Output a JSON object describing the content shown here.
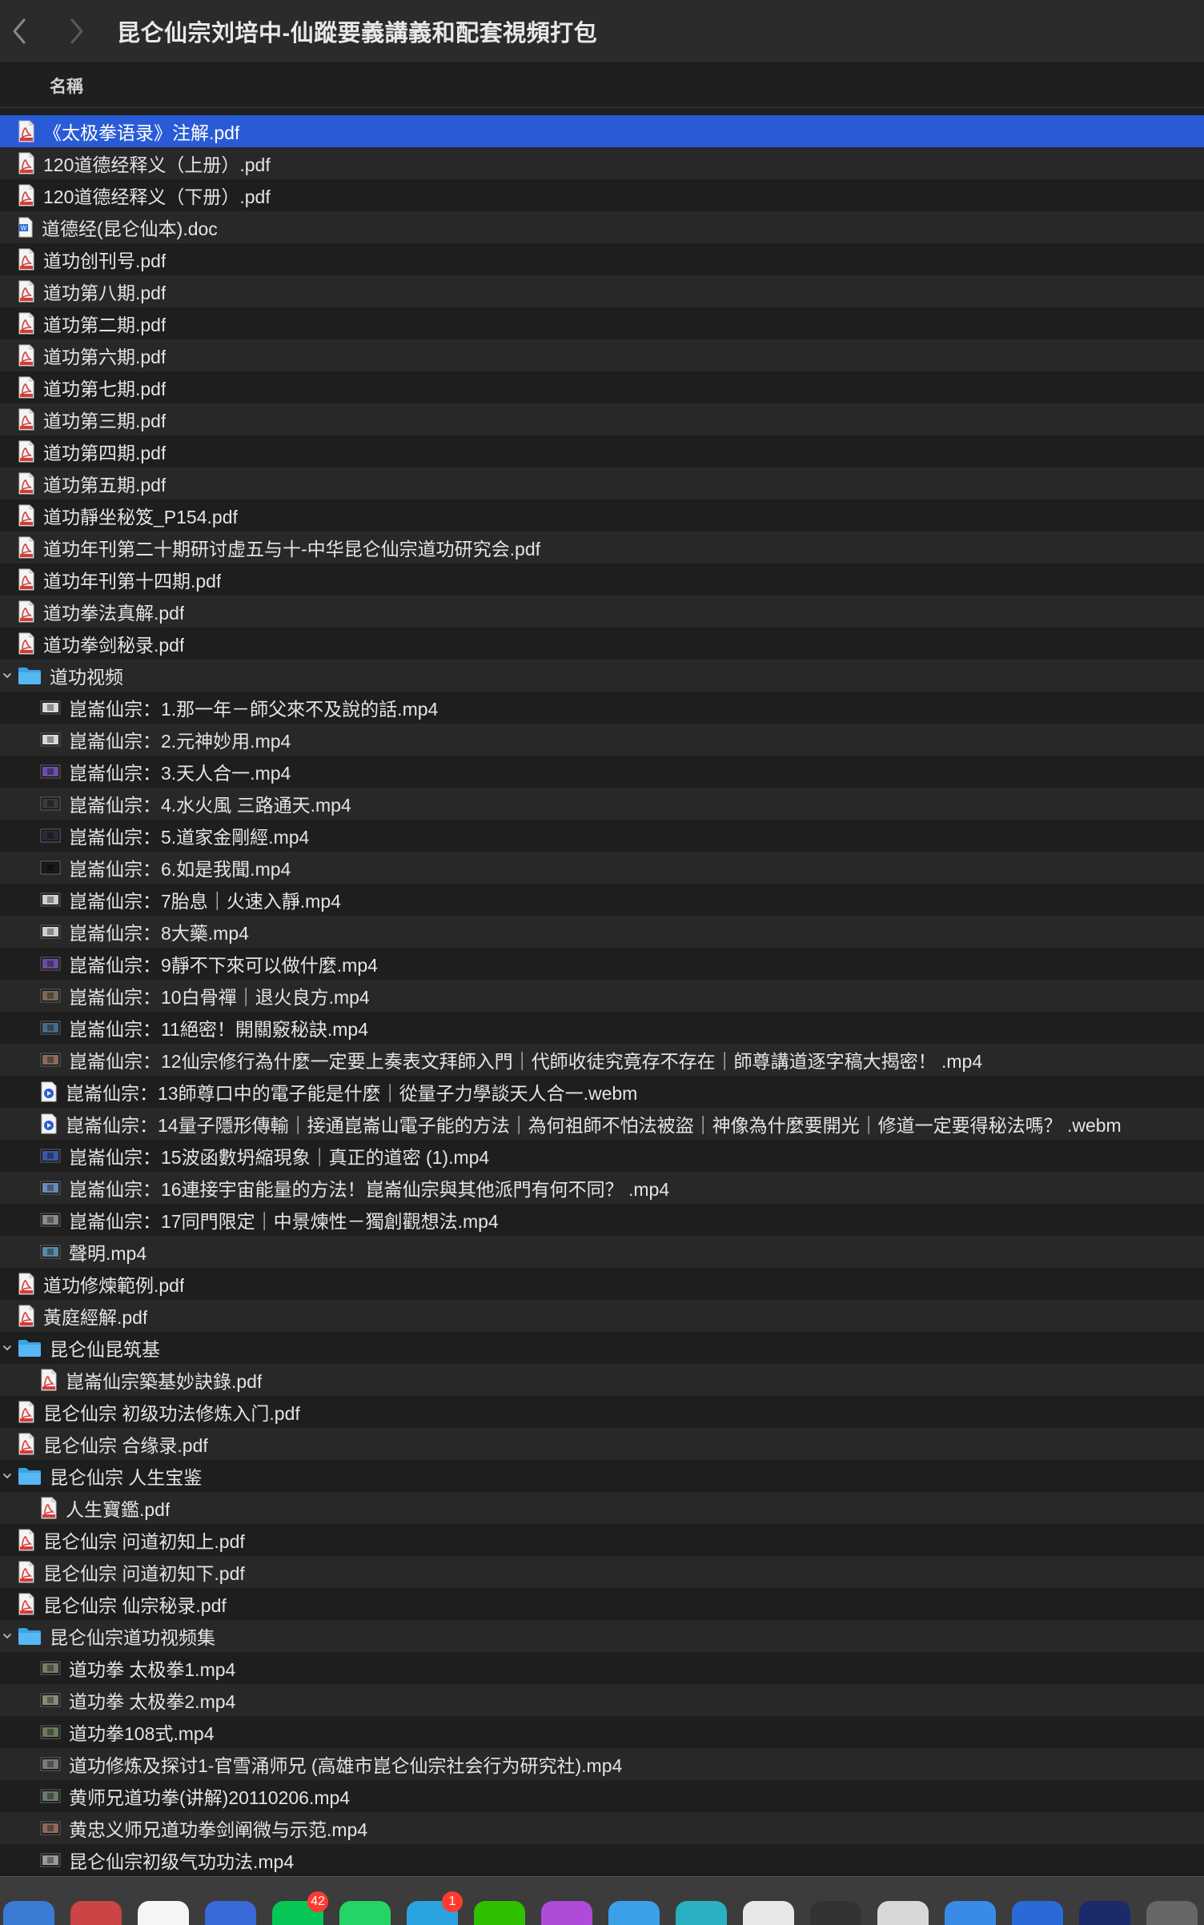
{
  "window": {
    "title": "昆仑仙宗刘培中-仙蹤要義講義和配套視頻打包",
    "back_label": "‹",
    "forward_label": "›"
  },
  "columns": {
    "name_header": "名稱"
  },
  "files": [
    {
      "name": "《太极拳语录》注解.pdf",
      "kind": "pdf",
      "level": 0,
      "selected": true
    },
    {
      "name": "120道德经释义（上册）.pdf",
      "kind": "pdf",
      "level": 0
    },
    {
      "name": "120道德经释义（下册）.pdf",
      "kind": "pdf",
      "level": 0
    },
    {
      "name": "道德经(昆仑仙本).doc",
      "kind": "doc",
      "level": 0
    },
    {
      "name": "道功创刊号.pdf",
      "kind": "pdf",
      "level": 0
    },
    {
      "name": "道功第八期.pdf",
      "kind": "pdf",
      "level": 0
    },
    {
      "name": "道功第二期.pdf",
      "kind": "pdf",
      "level": 0
    },
    {
      "name": "道功第六期.pdf",
      "kind": "pdf",
      "level": 0
    },
    {
      "name": "道功第七期.pdf",
      "kind": "pdf",
      "level": 0
    },
    {
      "name": "道功第三期.pdf",
      "kind": "pdf",
      "level": 0
    },
    {
      "name": "道功第四期.pdf",
      "kind": "pdf",
      "level": 0
    },
    {
      "name": "道功第五期.pdf",
      "kind": "pdf",
      "level": 0
    },
    {
      "name": "道功靜坐秘笈_P154.pdf",
      "kind": "pdf",
      "level": 0
    },
    {
      "name": "道功年刊第二十期研讨虚五与十-中华昆仑仙宗道功研究会.pdf",
      "kind": "pdf",
      "level": 0
    },
    {
      "name": "道功年刊第十四期.pdf",
      "kind": "pdf",
      "level": 0
    },
    {
      "name": "道功拳法真解.pdf",
      "kind": "pdf",
      "level": 0
    },
    {
      "name": "道功拳剑秘录.pdf",
      "kind": "pdf",
      "level": 0
    },
    {
      "name": "道功视频",
      "kind": "folder",
      "level": 0,
      "expanded": true
    },
    {
      "name": "崑崙仙宗：1.那一年－師父來不及說的話.mp4",
      "kind": "video",
      "level": 1,
      "thumb": "#d8d8d8"
    },
    {
      "name": "崑崙仙宗：2.元神妙用.mp4",
      "kind": "video",
      "level": 1,
      "thumb": "#d8d8d8"
    },
    {
      "name": "崑崙仙宗：3.天人合一.mp4",
      "kind": "video",
      "level": 1,
      "thumb": "#6b4fa8"
    },
    {
      "name": "崑崙仙宗：4.水火風 三路通天.mp4",
      "kind": "video",
      "level": 1,
      "thumb": "#3a3a3a"
    },
    {
      "name": "崑崙仙宗：5.道家金剛經.mp4",
      "kind": "video",
      "level": 1,
      "thumb": "#2b2b3a"
    },
    {
      "name": "崑崙仙宗：6.如是我聞.mp4",
      "kind": "video",
      "level": 1,
      "thumb": "#1a1a1a"
    },
    {
      "name": "崑崙仙宗：7胎息｜火速入靜.mp4",
      "kind": "video",
      "level": 1,
      "thumb": "#cfcfcf"
    },
    {
      "name": "崑崙仙宗：8大藥.mp4",
      "kind": "video",
      "level": 1,
      "thumb": "#cfcfcf"
    },
    {
      "name": "崑崙仙宗：9靜不下來可以做什麼.mp4",
      "kind": "video",
      "level": 1,
      "thumb": "#6a4ea3"
    },
    {
      "name": "崑崙仙宗：10白骨禪｜退火良方.mp4",
      "kind": "video",
      "level": 1,
      "thumb": "#7a6a5a"
    },
    {
      "name": "崑崙仙宗：11絕密！開關竅秘訣.mp4",
      "kind": "video",
      "level": 1,
      "thumb": "#4a6a8a"
    },
    {
      "name": "崑崙仙宗：12仙宗修行為什麼一定要上奏表文拜師入門｜代師收徒究竟存不存在｜師尊講道逐字稿大揭密！ .mp4",
      "kind": "video",
      "level": 1,
      "thumb": "#8a6a5a"
    },
    {
      "name": "崑崙仙宗：13師尊口中的電子能是什麼｜從量子力學談天人合一.webm",
      "kind": "webm",
      "level": 1
    },
    {
      "name": "崑崙仙宗：14量子隱形傳輸｜接通崑崙山電子能的方法｜為何祖師不怕法被盜｜神像為什麼要開光｜修道一定要得秘法嗎？ .webm",
      "kind": "webm",
      "level": 1
    },
    {
      "name": "崑崙仙宗：15波函數坍縮現象｜真正的道密 (1).mp4",
      "kind": "video",
      "level": 1,
      "thumb": "#3a5aa8"
    },
    {
      "name": "崑崙仙宗：16連接宇宙能量的方法！崑崙仙宗與其他派門有何不同？ .mp4",
      "kind": "video",
      "level": 1,
      "thumb": "#6a8ab8"
    },
    {
      "name": "崑崙仙宗：17同門限定｜中景煉性－獨創觀想法.mp4",
      "kind": "video",
      "level": 1,
      "thumb": "#8a8a8a"
    },
    {
      "name": "聲明.mp4",
      "kind": "video",
      "level": 1,
      "thumb": "#5a8aa8"
    },
    {
      "name": "道功修煉範例.pdf",
      "kind": "pdf",
      "level": 0
    },
    {
      "name": "黃庭經解.pdf",
      "kind": "pdf",
      "level": 0
    },
    {
      "name": "昆仑仙昆筑基",
      "kind": "folder",
      "level": 0,
      "expanded": true
    },
    {
      "name": "崑崙仙宗築基妙訣錄.pdf",
      "kind": "pdf",
      "level": 1
    },
    {
      "name": "昆仑仙宗 初级功法修炼入门.pdf",
      "kind": "pdf",
      "level": 0
    },
    {
      "name": "昆仑仙宗 合缘录.pdf",
      "kind": "pdf",
      "level": 0
    },
    {
      "name": "昆仑仙宗 人生宝鉴",
      "kind": "folder",
      "level": 0,
      "expanded": true
    },
    {
      "name": "人生寶鑑.pdf",
      "kind": "pdf",
      "level": 1
    },
    {
      "name": "昆仑仙宗 问道初知上.pdf",
      "kind": "pdf",
      "level": 0
    },
    {
      "name": "昆仑仙宗 问道初知下.pdf",
      "kind": "pdf",
      "level": 0
    },
    {
      "name": "昆仑仙宗 仙宗秘录.pdf",
      "kind": "pdf",
      "level": 0
    },
    {
      "name": "昆仑仙宗道功视频集",
      "kind": "folder",
      "level": 0,
      "expanded": true
    },
    {
      "name": "道功拳 太极拳1.mp4",
      "kind": "video",
      "level": 1,
      "thumb": "#7a7a6a"
    },
    {
      "name": "道功拳 太极拳2.mp4",
      "kind": "video",
      "level": 1,
      "thumb": "#8a8a7a"
    },
    {
      "name": "道功拳108式.mp4",
      "kind": "video",
      "level": 1,
      "thumb": "#6a7a5a"
    },
    {
      "name": "道功修炼及探讨1-官雪涌师兄 (高雄市崑仑仙宗社会行为研究社).mp4",
      "kind": "video",
      "level": 1,
      "thumb": "#7a7a7a"
    },
    {
      "name": "黄师兄道功拳(讲解)20110206.mp4",
      "kind": "video",
      "level": 1,
      "thumb": "#6a7a6a"
    },
    {
      "name": "黄忠义师兄道功拳剑阐微与示范.mp4",
      "kind": "video",
      "level": 1,
      "thumb": "#8a6a5a"
    },
    {
      "name": "昆仑仙宗初级气功功法.mp4",
      "kind": "video",
      "level": 1,
      "thumb": "#9a9a9a"
    }
  ],
  "dock": {
    "apps": [
      {
        "name": "mail-app-icon",
        "color": "#3a7bd5"
      },
      {
        "name": "photo-booth-app-icon",
        "color": "#c44"
      },
      {
        "name": "qq-app-icon",
        "color": "#f5f5f5"
      },
      {
        "name": "feishu-app-icon",
        "color": "#3a6ad8"
      },
      {
        "name": "line-app-icon",
        "color": "#06c755",
        "badge": "42"
      },
      {
        "name": "whatsapp-app-icon",
        "color": "#25d366"
      },
      {
        "name": "telegram-app-icon",
        "color": "#2aa3e0",
        "badge": "1"
      },
      {
        "name": "wechat-app-icon",
        "color": "#2dc100"
      },
      {
        "name": "messenger-app-icon",
        "color": "#b04ad8"
      },
      {
        "name": "bird-app-icon",
        "color": "#3aa0e8"
      },
      {
        "name": "teal-app-icon",
        "color": "#2ab0c0"
      },
      {
        "name": "mail-envelope-app-icon",
        "color": "#e8e8e8"
      },
      {
        "name": "music-app-icon",
        "color": "#333"
      },
      {
        "name": "airmail-app-icon",
        "color": "#d8d8d8"
      },
      {
        "name": "safari-app-icon",
        "color": "#3a8ae8"
      },
      {
        "name": "shield-app-icon",
        "color": "#2a6ad8"
      },
      {
        "name": "navy-app-icon",
        "color": "#1a2a6a"
      },
      {
        "name": "help-app-icon",
        "color": "#666"
      }
    ]
  }
}
